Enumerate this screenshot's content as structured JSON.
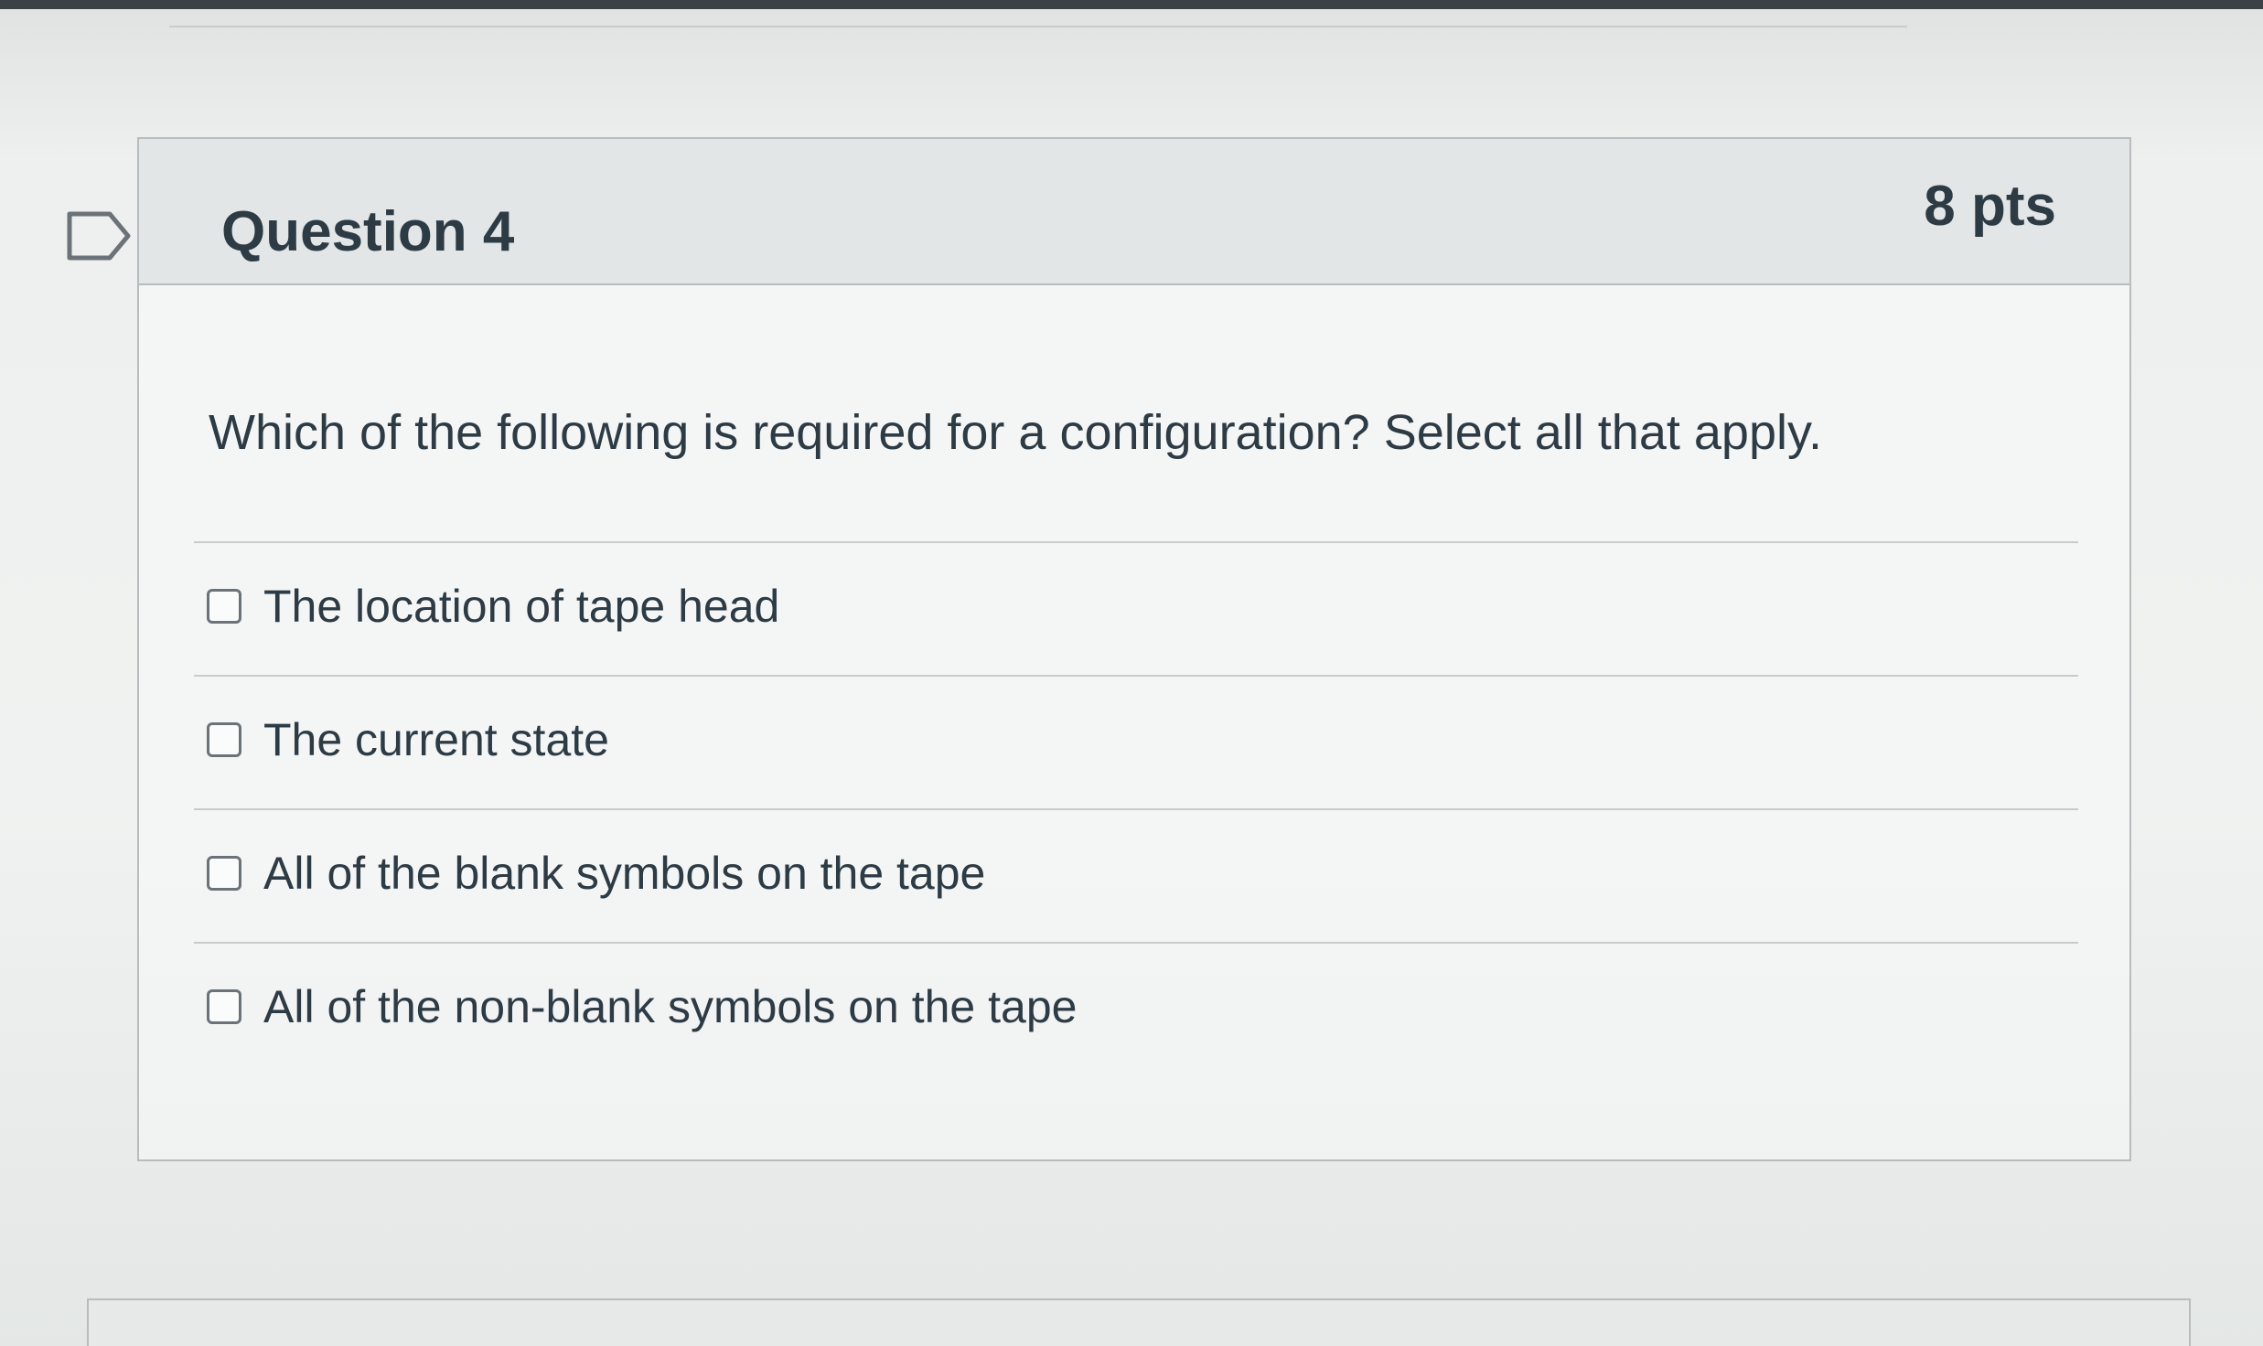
{
  "question": {
    "title": "Question 4",
    "points": "8 pts",
    "text": "Which of the following is required for a configuration?  Select all that apply.",
    "flag_icon": "flag-outline-icon"
  },
  "answers": [
    {
      "label": "The location of tape head",
      "checked": false
    },
    {
      "label": "The current state",
      "checked": false
    },
    {
      "label": "All of the blank symbols on the tape",
      "checked": false
    },
    {
      "label": "All of the non-blank symbols on the tape",
      "checked": false
    }
  ],
  "colors": {
    "text": "#2d3b45",
    "header_bg": "#e3e6e6",
    "border": "#b9bcbc",
    "checkbox_border": "#6b7378"
  }
}
